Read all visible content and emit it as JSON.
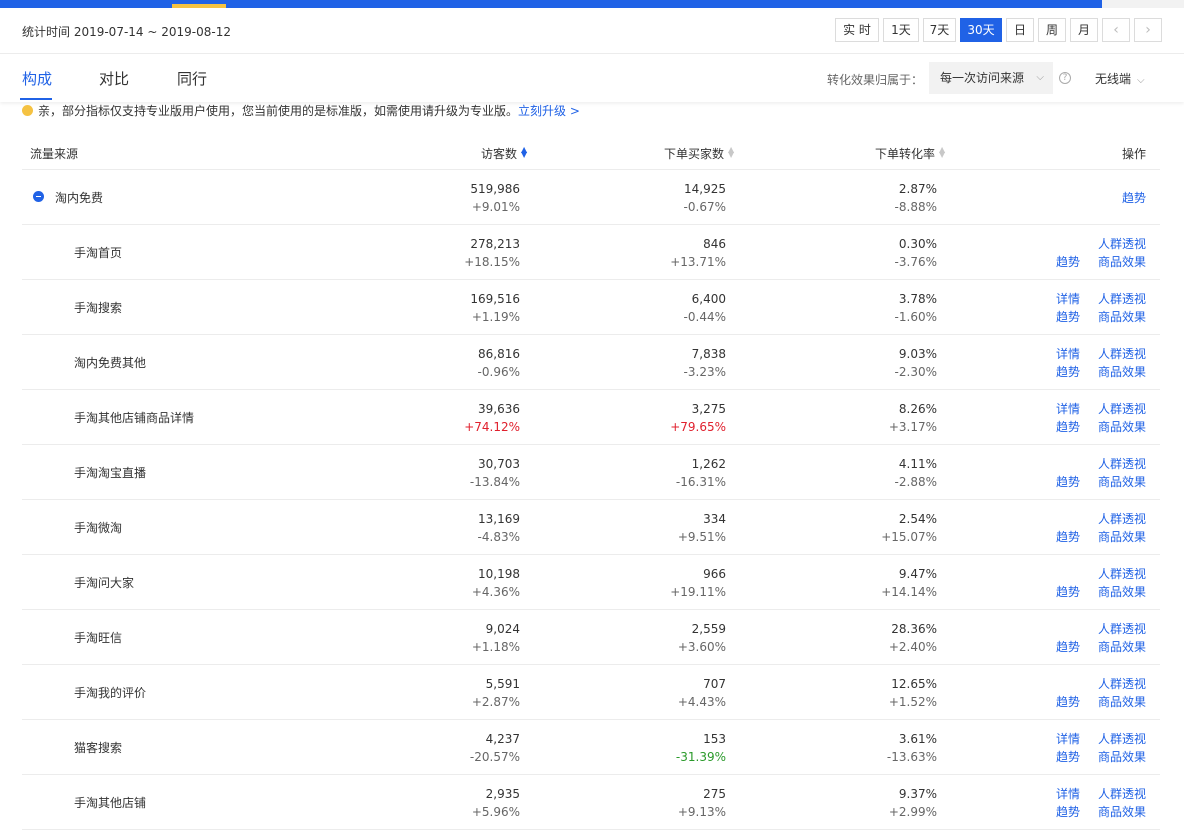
{
  "period": {
    "label": "统计时间 2019-07-14 ~ 2019-08-12",
    "buttons": [
      "实 时",
      "1天",
      "7天",
      "30天",
      "日",
      "周",
      "月"
    ],
    "active": "30天",
    "prev": "‹",
    "next": "›"
  },
  "tabs": [
    "构成",
    "对比",
    "同行"
  ],
  "active_tab": "构成",
  "attribution": {
    "label": "转化效果归属于：",
    "value": "每一次访问来源",
    "help": "?",
    "device": "无线端"
  },
  "notice": {
    "text": "亲，部分指标仅支持专业版用户使用，您当前使用的是标准版，如需使用请升级为专业版。",
    "link": "立刻升级 >"
  },
  "table": {
    "headers": {
      "source": "流量来源",
      "visitors": "访客数",
      "buyers": "下单买家数",
      "rate": "下单转化率",
      "ops": "操作"
    },
    "ops_labels": {
      "detail": "详情",
      "crowd": "人群透视",
      "trend": "趋势",
      "goods": "商品效果"
    },
    "parent": {
      "name": "淘内免费",
      "visitors": "519,986",
      "visitors_chg": "+9.01%",
      "buyers": "14,925",
      "buyers_chg": "-0.67%",
      "rate": "2.87%",
      "rate_chg": "-8.88%",
      "op": "趋势"
    },
    "rows": [
      {
        "name": "手淘首页",
        "visitors": "278,213",
        "visitors_chg": "+18.15%",
        "buyers": "846",
        "buyers_chg": "+13.71%",
        "rate": "0.30%",
        "rate_chg": "-3.76%",
        "detail": false
      },
      {
        "name": "手淘搜索",
        "visitors": "169,516",
        "visitors_chg": "+1.19%",
        "buyers": "6,400",
        "buyers_chg": "-0.44%",
        "rate": "3.78%",
        "rate_chg": "-1.60%",
        "detail": true
      },
      {
        "name": "淘内免费其他",
        "visitors": "86,816",
        "visitors_chg": "-0.96%",
        "buyers": "7,838",
        "buyers_chg": "-3.23%",
        "rate": "9.03%",
        "rate_chg": "-2.30%",
        "detail": true
      },
      {
        "name": "手淘其他店铺商品详情",
        "visitors": "39,636",
        "visitors_chg": "+74.12%",
        "visitors_chg_style": "up-red",
        "buyers": "3,275",
        "buyers_chg": "+79.65%",
        "buyers_chg_style": "up-red",
        "rate": "8.26%",
        "rate_chg": "+3.17%",
        "detail": true
      },
      {
        "name": "手淘淘宝直播",
        "visitors": "30,703",
        "visitors_chg": "-13.84%",
        "buyers": "1,262",
        "buyers_chg": "-16.31%",
        "rate": "4.11%",
        "rate_chg": "-2.88%",
        "detail": false
      },
      {
        "name": "手淘微淘",
        "visitors": "13,169",
        "visitors_chg": "-4.83%",
        "buyers": "334",
        "buyers_chg": "+9.51%",
        "rate": "2.54%",
        "rate_chg": "+15.07%",
        "detail": false
      },
      {
        "name": "手淘问大家",
        "visitors": "10,198",
        "visitors_chg": "+4.36%",
        "buyers": "966",
        "buyers_chg": "+19.11%",
        "rate": "9.47%",
        "rate_chg": "+14.14%",
        "detail": false
      },
      {
        "name": "手淘旺信",
        "visitors": "9,024",
        "visitors_chg": "+1.18%",
        "buyers": "2,559",
        "buyers_chg": "+3.60%",
        "rate": "28.36%",
        "rate_chg": "+2.40%",
        "detail": false
      },
      {
        "name": "手淘我的评价",
        "visitors": "5,591",
        "visitors_chg": "+2.87%",
        "buyers": "707",
        "buyers_chg": "+4.43%",
        "rate": "12.65%",
        "rate_chg": "+1.52%",
        "detail": false
      },
      {
        "name": "猫客搜索",
        "visitors": "4,237",
        "visitors_chg": "-20.57%",
        "buyers": "153",
        "buyers_chg": "-31.39%",
        "buyers_chg_style": "down-green",
        "rate": "3.61%",
        "rate_chg": "-13.63%",
        "detail": true
      },
      {
        "name": "手淘其他店铺",
        "visitors": "2,935",
        "visitors_chg": "+5.96%",
        "buyers": "275",
        "buyers_chg": "+9.13%",
        "rate": "9.37%",
        "rate_chg": "+2.99%",
        "detail": true
      }
    ]
  }
}
